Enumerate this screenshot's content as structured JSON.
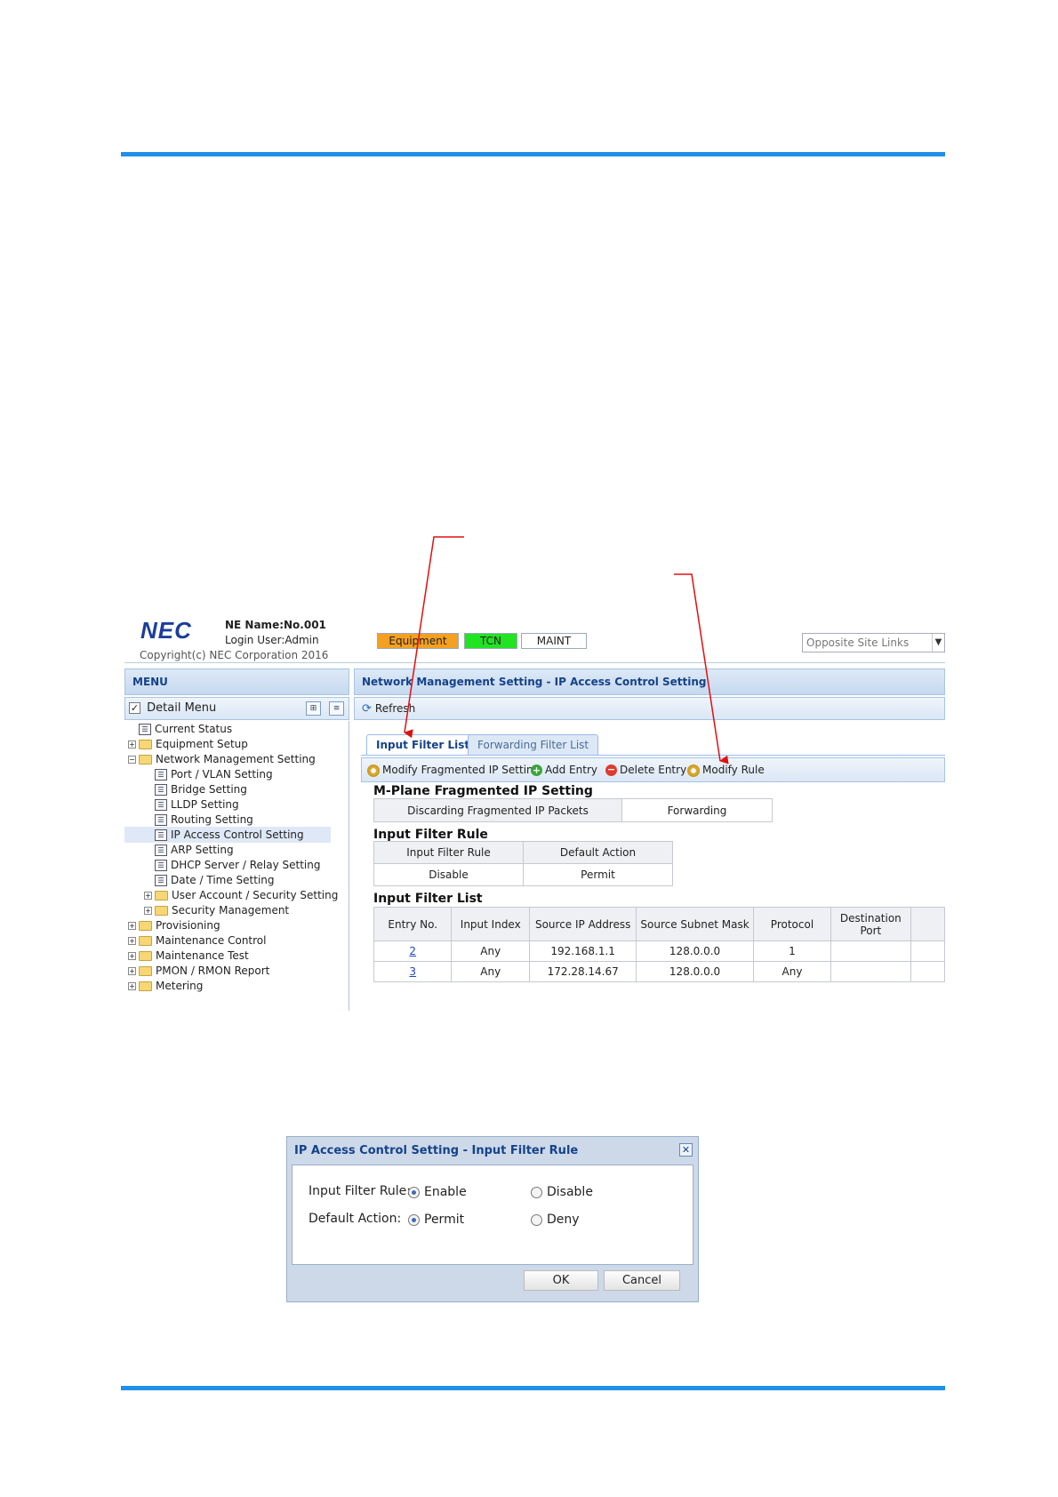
{
  "header": {
    "logo": "NEC",
    "ne_name": "NE Name:No.001",
    "login_user": "Login User:Admin",
    "copyright": "Copyright(c) NEC Corporation 2016",
    "status": {
      "equipment": "Equipment",
      "tcn": "TCN",
      "maint": "MAINT"
    },
    "opposite_site_links": "Opposite Site Links"
  },
  "menu": {
    "title": "MENU",
    "detail_menu": "Detail Menu",
    "items": [
      {
        "label": "Current Status"
      },
      {
        "label": "Equipment Setup"
      },
      {
        "label": "Network Management Setting"
      },
      {
        "label": "Port / VLAN Setting"
      },
      {
        "label": "Bridge Setting"
      },
      {
        "label": "LLDP Setting"
      },
      {
        "label": "Routing Setting"
      },
      {
        "label": "IP Access Control Setting"
      },
      {
        "label": "ARP Setting"
      },
      {
        "label": "DHCP Server / Relay Setting"
      },
      {
        "label": "Date / Time Setting"
      },
      {
        "label": "User Account / Security Setting"
      },
      {
        "label": "Security Management"
      },
      {
        "label": "Provisioning"
      },
      {
        "label": "Maintenance Control"
      },
      {
        "label": "Maintenance Test"
      },
      {
        "label": "PMON / RMON Report"
      },
      {
        "label": "Metering"
      }
    ]
  },
  "content": {
    "breadcrumb": "Network Management Setting - IP Access Control Setting",
    "refresh": "Refresh",
    "tabs": [
      "Input Filter List",
      "Forwarding Filter List"
    ],
    "toolbar": {
      "modify_fragmented": "Modify Fragmented IP Setting",
      "add_entry": "Add Entry",
      "delete_entry": "Delete Entry",
      "modify_rule": "Modify Rule"
    },
    "fragmented": {
      "title": "M-Plane Fragmented IP Setting",
      "label": "Discarding Fragmented IP Packets",
      "value": "Forwarding"
    },
    "filter_rule": {
      "title": "Input Filter Rule",
      "headers": [
        "Input Filter Rule",
        "Default Action"
      ],
      "values": [
        "Disable",
        "Permit"
      ]
    },
    "filter_list": {
      "title": "Input Filter List",
      "headers": [
        "Entry No.",
        "Input Index",
        "Source IP Address",
        "Source Subnet Mask",
        "Protocol",
        "Destination Port"
      ],
      "rows": [
        [
          "2",
          "Any",
          "192.168.1.1",
          "128.0.0.0",
          "1",
          ""
        ],
        [
          "3",
          "Any",
          "172.28.14.67",
          "128.0.0.0",
          "Any",
          ""
        ]
      ]
    }
  },
  "dialog": {
    "title": "IP Access Control Setting - Input Filter Rule",
    "input_filter_rule_label": "Input Filter Rule:",
    "default_action_label": "Default Action:",
    "enable": "Enable",
    "disable": "Disable",
    "permit": "Permit",
    "deny": "Deny",
    "ok": "OK",
    "cancel": "Cancel"
  },
  "colors": {
    "accent": "#1e90e8",
    "equipment": "#f4a020",
    "tcn": "#22e322",
    "arrow": "#e01010"
  }
}
